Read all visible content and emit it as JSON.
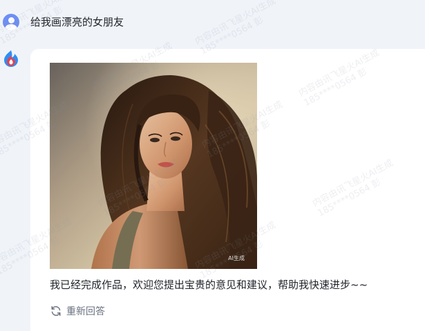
{
  "user_message": {
    "text": "给我画漂亮的女朋友"
  },
  "bot_message": {
    "image_tag": "AI生成",
    "reply_text": "我已经完成作品，欢迎您提出宝贵的意见和建议，帮助我快速进步~~",
    "regenerate_label": "重新回答"
  },
  "watermark": {
    "line1": "内容由讯飞星火AI生成",
    "line2": "185****0564 彭"
  },
  "colors": {
    "page_bg": "#f0f4f9",
    "card_bg": "#ffffff",
    "user_avatar": "#6d8ef5",
    "text": "#1f2329",
    "muted": "#6b7280"
  }
}
